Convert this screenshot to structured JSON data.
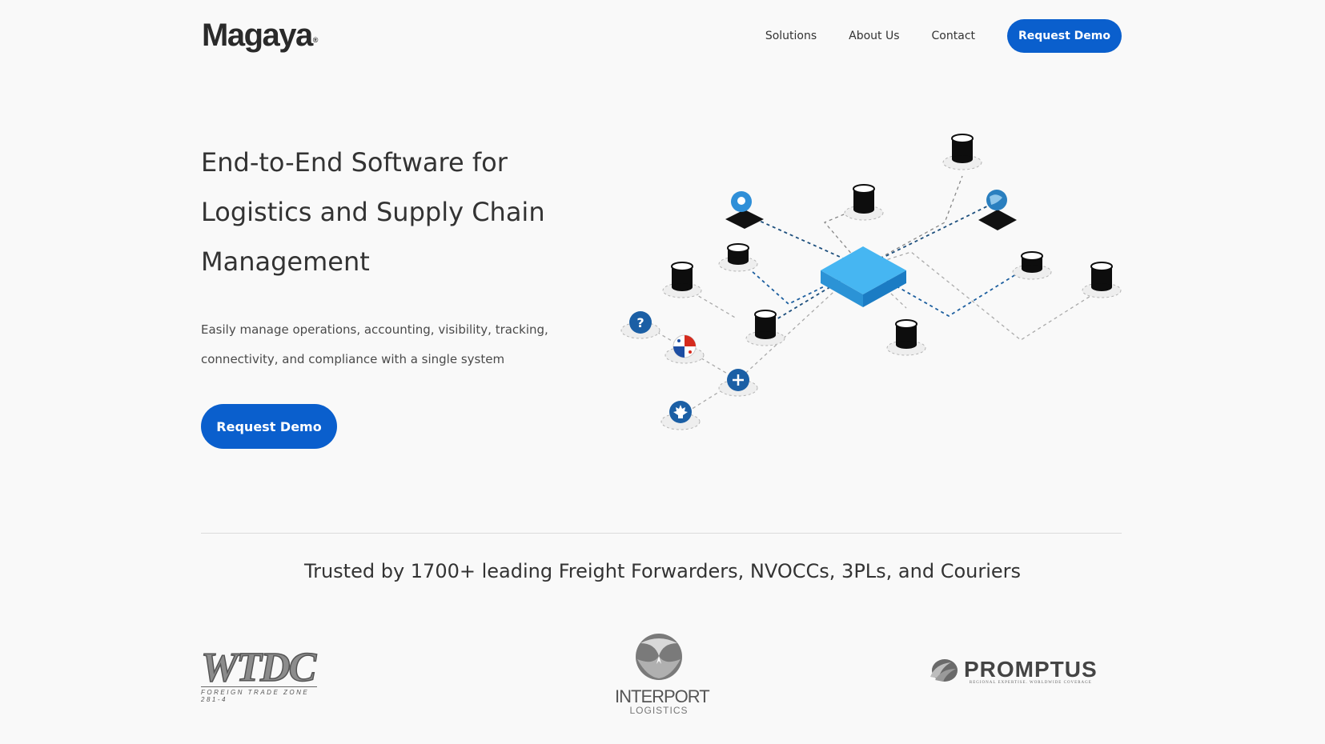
{
  "header": {
    "logo_text": "Magaya",
    "logo_mark": "®",
    "nav": [
      "Solutions",
      "About Us",
      "Contact"
    ],
    "cta_label": "Request Demo"
  },
  "hero": {
    "title": "End-to-End Software for Logistics and Supply Chain Management",
    "subtitle": "Easily manage operations, accounting, visibility, tracking, connectivity, and compliance with a single system",
    "cta_label": "Request Demo",
    "illustration_icons": [
      "location-pin-icon",
      "globe-icon",
      "question-icon",
      "panama-flag-icon",
      "plus-icon",
      "maple-leaf-icon",
      "database-icon",
      "hub-box-icon"
    ]
  },
  "trusted": {
    "heading": "Trusted by 1700+ leading Freight Forwarders, NVOCCs, 3PLs, and Couriers",
    "logos": [
      {
        "name": "WTDC",
        "tagline": "FOREIGN TRADE ZONE 281-4"
      },
      {
        "name": "INTERPORT",
        "tagline": "LOGISTICS"
      },
      {
        "name": "PROMPTUS",
        "tagline": "REGIONAL EXPERTISE. WORLDWIDE COVERAGE"
      }
    ]
  },
  "colors": {
    "brand_blue": "#0a5fcd",
    "hub_blue": "#3aaef0",
    "link_dark_blue": "#1a5fa0",
    "background": "#f9f9f9"
  }
}
